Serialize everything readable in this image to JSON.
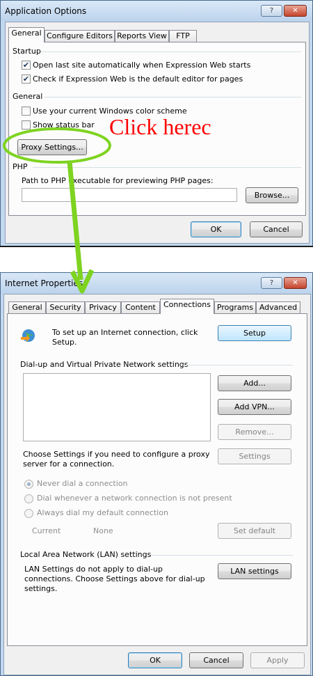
{
  "app_options": {
    "title": "Application Options",
    "help_btn": "?",
    "close_btn": "X",
    "tabs": [
      "General",
      "Configure Editors",
      "Reports View",
      "FTP"
    ],
    "startup_group": "Startup",
    "startup_items": [
      {
        "label": "Open last site automatically when Expression Web starts",
        "checked": true
      },
      {
        "label": "Check if Expression Web is the default editor for pages",
        "checked": true
      }
    ],
    "general_group": "General",
    "general_items": [
      {
        "label": "Use your current Windows color scheme",
        "checked": false
      },
      {
        "label": "Show status bar",
        "checked": false
      }
    ],
    "proxy_button": "Proxy Settings...",
    "php_group": "PHP",
    "php_path_label": "Path to PHP executable for previewing PHP pages:",
    "php_path_value": "",
    "browse_button": "Browse...",
    "ok_button": "OK",
    "cancel_button": "Cancel"
  },
  "annotation": {
    "text": "Click herec",
    "color": "#ff0000",
    "highlight_color": "#7ed321"
  },
  "internet_properties": {
    "title": "Internet Properties",
    "help_btn": "?",
    "close_btn": "X",
    "tabs": [
      "General",
      "Security",
      "Privacy",
      "Content",
      "Connections",
      "Programs",
      "Advanced"
    ],
    "active_tab": "Connections",
    "setup_text": "To set up an Internet connection, click Setup.",
    "setup_button": "Setup",
    "dialup_group": "Dial-up and Virtual Private Network settings",
    "add_button": "Add...",
    "add_vpn_button": "Add VPN...",
    "remove_button": "Remove...",
    "settings_text": "Choose Settings if you need to configure a proxy server for a connection.",
    "settings_button": "Settings",
    "radio_options": [
      {
        "label": "Never dial a connection",
        "selected": true
      },
      {
        "label": "Dial whenever a network connection is not present",
        "selected": false
      },
      {
        "label": "Always dial my default connection",
        "selected": false
      }
    ],
    "current_label": "Current",
    "current_value": "None",
    "set_default_button": "Set default",
    "lan_group": "Local Area Network (LAN) settings",
    "lan_text": "LAN Settings do not apply to dial-up connections. Choose Settings above for dial-up settings.",
    "lan_button": "LAN settings",
    "ok_button": "OK",
    "cancel_button": "Cancel",
    "apply_button": "Apply"
  }
}
